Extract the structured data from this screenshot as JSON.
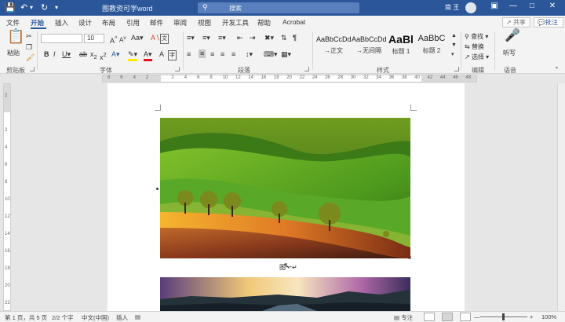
{
  "titlebar": {
    "doc_title": "图教资可学word",
    "search_placeholder": "搜索",
    "user_name": "简 王",
    "autosave_icon": "save-icon",
    "undo_icon": "undo-icon",
    "redo_icon": "redo-icon",
    "customize_icon": "customize-icon"
  },
  "tabs": {
    "items": [
      "文件",
      "开始",
      "插入",
      "设计",
      "布局",
      "引用",
      "邮件",
      "审阅",
      "视图",
      "开发工具",
      "帮助",
      "Acrobat"
    ],
    "active": "开始",
    "share_label": "共享",
    "comment_label": "批注"
  },
  "ribbon": {
    "clipboard": {
      "label": "剪贴板",
      "paste_label": "粘贴"
    },
    "font": {
      "label": "字体",
      "font_name": "",
      "font_size": "10"
    },
    "paragraph": {
      "label": "段落"
    },
    "styles": {
      "label": "样式",
      "items": [
        {
          "sample": "AaBbCcDd",
          "name": "→正文"
        },
        {
          "sample": "AaBbCcDd",
          "name": "→无间隔"
        },
        {
          "sample": "AaBl",
          "name": "标题 1"
        },
        {
          "sample": "AaBbC",
          "name": "标题 2"
        }
      ]
    },
    "editing": {
      "label": "编辑",
      "find": "查找",
      "replace": "替换",
      "select": "选择"
    },
    "voice": {
      "label": "语音",
      "dictate": "听写"
    }
  },
  "ruler": {
    "numbers": [
      "8",
      "6",
      "4",
      "2",
      "",
      "2",
      "4",
      "6",
      "8",
      "10",
      "12",
      "14",
      "16",
      "18",
      "20",
      "22",
      "24",
      "26",
      "28",
      "30",
      "32",
      "34",
      "36",
      "38",
      "40",
      "42",
      "44",
      "46",
      "48"
    ]
  },
  "vruler": {
    "numbers": [
      "2",
      "",
      "2",
      "4",
      "6",
      "8",
      "10",
      "12",
      "14",
      "16",
      "18",
      "20",
      "22"
    ]
  },
  "document": {
    "caption": "图一↵"
  },
  "status": {
    "page": "第 1 页，共 5 页",
    "words": "2/2 个字",
    "language": "中文(中国)",
    "mode": "插入",
    "focus": "专注",
    "zoom": "100%"
  },
  "colors": {
    "accent": "#2b579a",
    "ribbon_bg": "#f3f3f3",
    "canvas_bg": "#e6e6e6"
  }
}
